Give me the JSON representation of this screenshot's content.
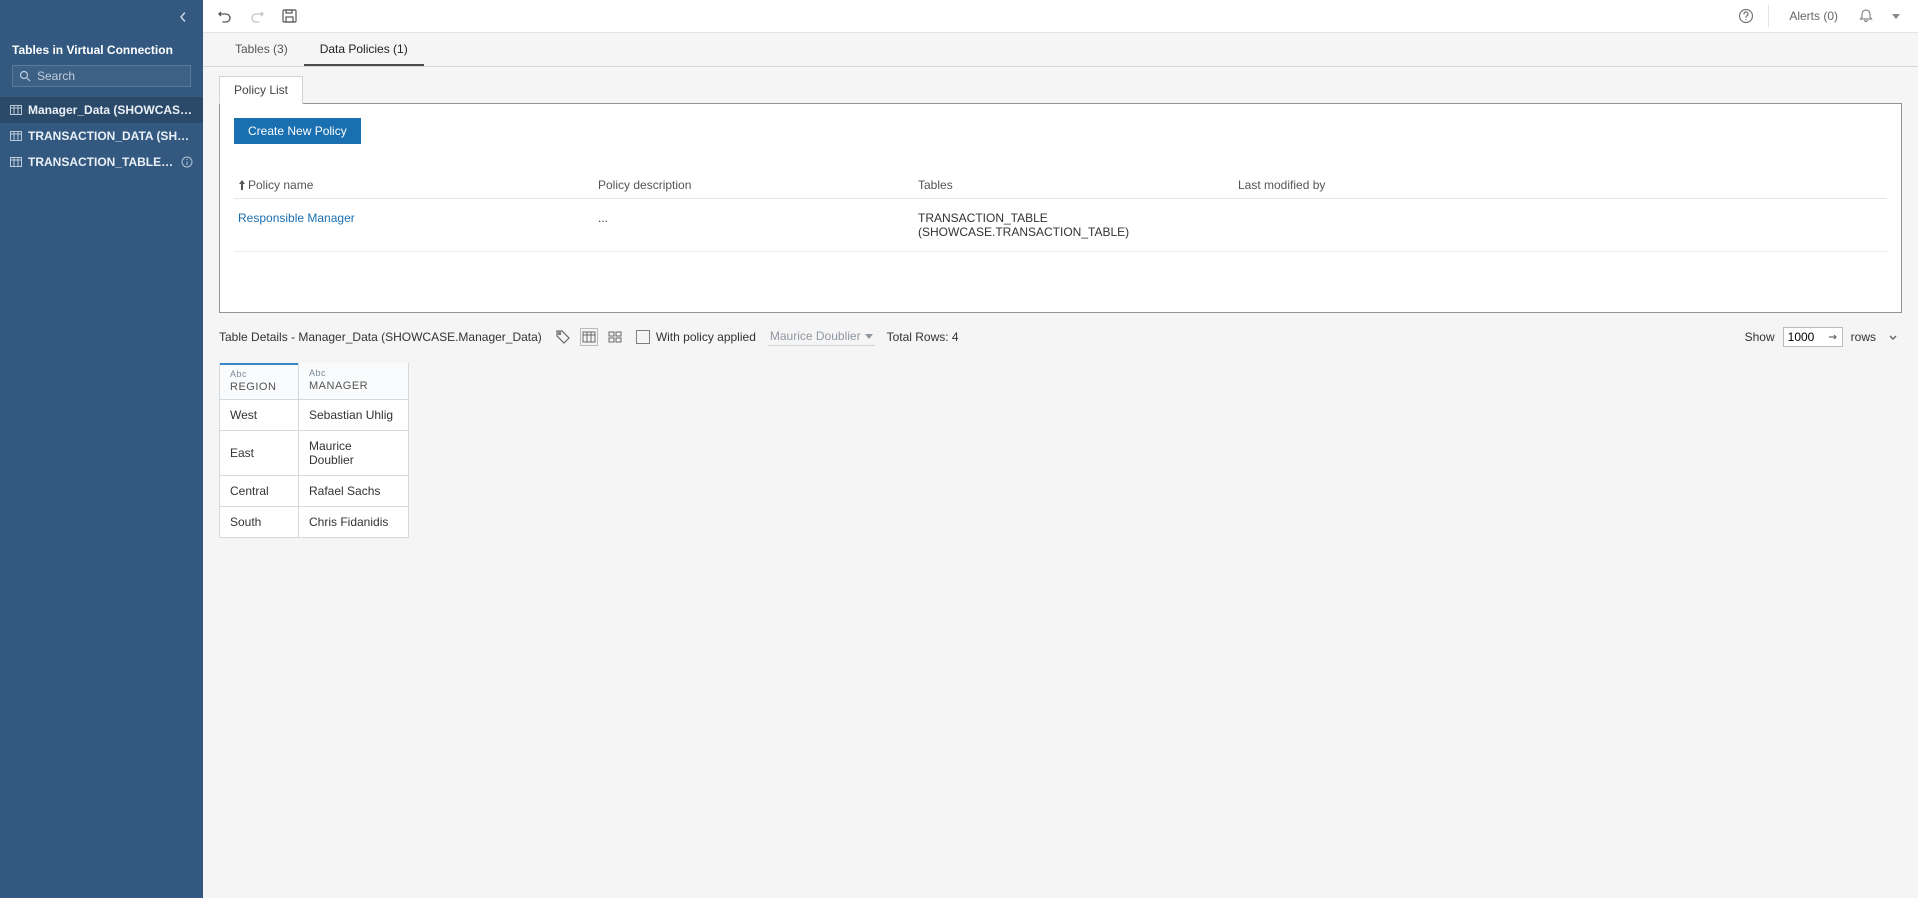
{
  "sidebar": {
    "title": "Tables in Virtual Connection",
    "search_placeholder": "Search",
    "items": [
      {
        "label": "Manager_Data (SHOWCASE....",
        "hasInfo": false
      },
      {
        "label": "TRANSACTION_DATA (SHOW...",
        "hasInfo": false
      },
      {
        "label": "TRANSACTION_TABLE (S...",
        "hasInfo": true
      }
    ]
  },
  "toolbar": {
    "help_tooltip": "Help",
    "alerts_label": "Alerts (0)"
  },
  "tabs": {
    "tables": "Tables (3)",
    "data_policies": "Data Policies (1)"
  },
  "subtab": {
    "policy_list": "Policy List"
  },
  "policy_pane": {
    "create_button": "Create New Policy",
    "columns": {
      "name": "Policy name",
      "desc": "Policy description",
      "tables": "Tables",
      "modified": "Last modified by"
    },
    "rows": [
      {
        "name": "Responsible Manager",
        "desc": "...",
        "tables": "TRANSACTION_TABLE (SHOWCASE.TRANSACTION_TABLE)",
        "modified": ""
      }
    ]
  },
  "details": {
    "title": "Table Details - Manager_Data (SHOWCASE.Manager_Data)",
    "with_policy_label": "With policy applied",
    "user": "Maurice Doublier",
    "total_rows_label": "Total Rows: 4",
    "show_label": "Show",
    "rows_value": "1000",
    "rows_suffix": "rows"
  },
  "grid": {
    "type_label": "Abc",
    "columns": [
      "REGION",
      "MANAGER"
    ],
    "data": [
      {
        "REGION": "West",
        "MANAGER": "Sebastian Uhlig"
      },
      {
        "REGION": "East",
        "MANAGER": "Maurice Doublier"
      },
      {
        "REGION": "Central",
        "MANAGER": "Rafael Sachs"
      },
      {
        "REGION": "South",
        "MANAGER": "Chris Fidanidis"
      }
    ]
  }
}
